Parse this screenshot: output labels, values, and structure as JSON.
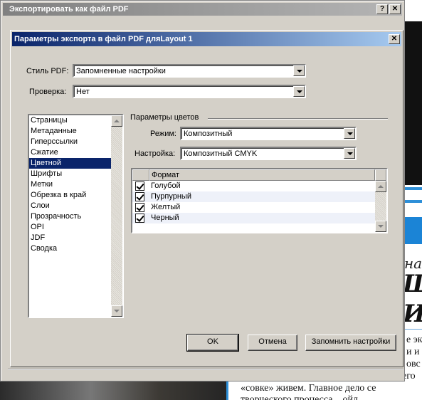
{
  "outer_window": {
    "title": "Экспортировать как файл PDF",
    "help_label": "?",
    "close_label": "✕"
  },
  "dialog": {
    "title": "Параметры экспорта в файл PDF дляLayout 1",
    "close_label": "✕"
  },
  "pdf_style": {
    "label": "Стиль PDF:",
    "value": "Запомненные настройки"
  },
  "verification": {
    "label": "Проверка:",
    "value": "Нет"
  },
  "sidebar": {
    "items": [
      {
        "label": "Страницы",
        "selected": false
      },
      {
        "label": "Метаданные",
        "selected": false
      },
      {
        "label": "Гиперссылки",
        "selected": false
      },
      {
        "label": "Сжатие",
        "selected": false
      },
      {
        "label": "Цветной",
        "selected": true
      },
      {
        "label": "Шрифты",
        "selected": false
      },
      {
        "label": "Метки",
        "selected": false
      },
      {
        "label": "Обрезка в край",
        "selected": false
      },
      {
        "label": "Слои",
        "selected": false
      },
      {
        "label": "Прозрачность",
        "selected": false
      },
      {
        "label": "OPI",
        "selected": false
      },
      {
        "label": "JDF",
        "selected": false
      },
      {
        "label": "Сводка",
        "selected": false
      }
    ]
  },
  "color_params": {
    "group_title": "Параметры цветов",
    "mode": {
      "label": "Режим:",
      "value": "Композитный"
    },
    "setting": {
      "label": "Настройка:",
      "value": "Композитный CMYK"
    },
    "format_table": {
      "header": "Формат",
      "rows": [
        {
          "name": "Голубой",
          "checked": true
        },
        {
          "name": "Пурпурный",
          "checked": true
        },
        {
          "name": "Желтый",
          "checked": true
        },
        {
          "name": "Черный",
          "checked": true
        }
      ]
    }
  },
  "buttons": {
    "ok": "OK",
    "cancel": "Отмена",
    "save": "Запомнить настройки"
  },
  "background": {
    "big_letter_1": "Ш",
    "big_letter_2": "И",
    "italic_text": "на",
    "text_lines": [
      "е эк",
      "и и",
      "овс",
      "его",
      "«совке» живем. Главное дело се",
      "творческого процесса... ойд"
    ]
  }
}
